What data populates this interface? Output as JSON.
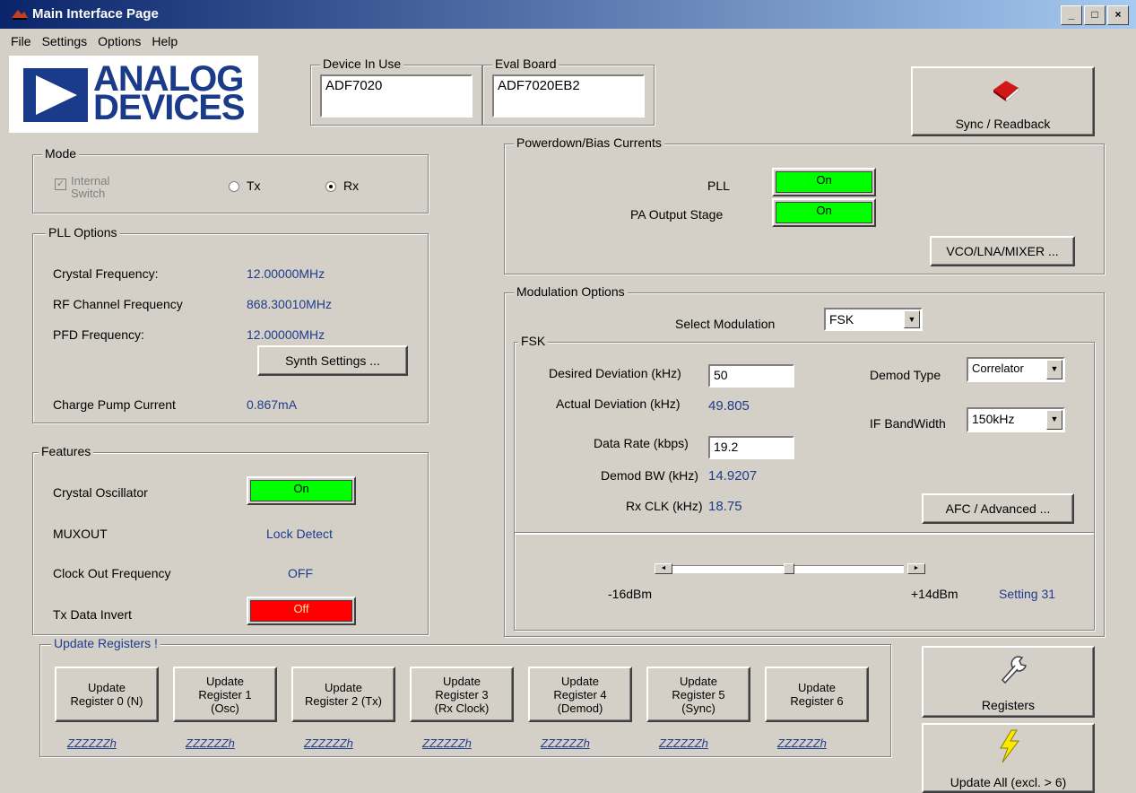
{
  "window": {
    "title": "Main Interface Page",
    "min": "_",
    "max": "□",
    "close": "×"
  },
  "menu": [
    "File",
    "Settings",
    "Options",
    "Help"
  ],
  "logo": {
    "line1": "ANALOG",
    "line2": "DEVICES"
  },
  "device": {
    "label": "Device In Use",
    "value": "ADF7020"
  },
  "eval": {
    "label": "Eval Board",
    "value": "ADF7020EB2"
  },
  "sync_button": "Sync / Readback",
  "mode": {
    "label": "Mode",
    "switch_label": "Internal Switch",
    "switch_checked": true,
    "tx": "Tx",
    "rx": "Rx",
    "selected": "Rx"
  },
  "pll": {
    "label": "PLL Options",
    "crystal_label": "Crystal  Frequency:",
    "crystal_value": "12.00000MHz",
    "rf_label": "RF Channel Frequency",
    "rf_value": "868.30010MHz",
    "pfd_label": "PFD Frequency:",
    "pfd_value": "12.00000MHz",
    "synth_button": "Synth Settings ...",
    "cp_label": "Charge Pump Current",
    "cp_value": "0.867mA"
  },
  "features": {
    "label": "Features",
    "xtal_label": "Crystal Oscillator",
    "xtal_state": "On",
    "muxout_label": "MUXOUT",
    "muxout_value": "Lock Detect",
    "clkout_label": "Clock Out Frequency",
    "clkout_value": "OFF",
    "txinv_label": "Tx Data Invert",
    "txinv_state": "Off"
  },
  "powerdown": {
    "label": "Powerdown/Bias Currents",
    "pll_label": "PLL",
    "pll_state": "On",
    "pa_label": "PA Output Stage",
    "pa_state": "On",
    "vco_button": "VCO/LNA/MIXER ..."
  },
  "modulation": {
    "label": "Modulation Options",
    "select_label": "Select Modulation",
    "select_value": "FSK",
    "fsk_label": "FSK",
    "desired_dev_label": "Desired Deviation (kHz)",
    "desired_dev_value": "50",
    "actual_dev_label": "Actual Deviation (kHz)",
    "actual_dev_value": "49.805",
    "data_rate_label": "Data Rate (kbps)",
    "data_rate_value": "19.2",
    "demod_bw_label": "Demod BW (kHz)",
    "demod_bw_value": "14.9207",
    "rxclk_label": "Rx CLK (kHz)",
    "rxclk_value": "18.75",
    "demod_type_label": "Demod Type",
    "demod_type_value": "Correlator",
    "ifbw_label": "IF BandWidth",
    "ifbw_value": "150kHz",
    "afc_button": "AFC / Advanced ...",
    "power_min": "-16dBm",
    "power_max": "+14dBm",
    "power_setting": "Setting 31",
    "power_level": 0.5
  },
  "update": {
    "label": "Update Registers !",
    "buttons": [
      {
        "l1": "Update",
        "l2": "Register 0 (N)",
        "l3": ""
      },
      {
        "l1": "Update",
        "l2": "Register 1",
        "l3": "(Osc)"
      },
      {
        "l1": "Update",
        "l2": "Register 2 (Tx)",
        "l3": ""
      },
      {
        "l1": "Update",
        "l2": "Register 3",
        "l3": "(Rx Clock)"
      },
      {
        "l1": "Update",
        "l2": "Register 4",
        "l3": "(Demod)"
      },
      {
        "l1": "Update",
        "l2": "Register 5",
        "l3": "(Sync)"
      },
      {
        "l1": "Update",
        "l2": "Register 6",
        "l3": ""
      }
    ],
    "hex": [
      "ZZZZZZh",
      "ZZZZZZh",
      "ZZZZZZh",
      "ZZZZZZh",
      "ZZZZZZh",
      "ZZZZZZh",
      "ZZZZZZh"
    ]
  },
  "registers_button": "Registers",
  "update_all_button": "Update All (excl. > 6)"
}
